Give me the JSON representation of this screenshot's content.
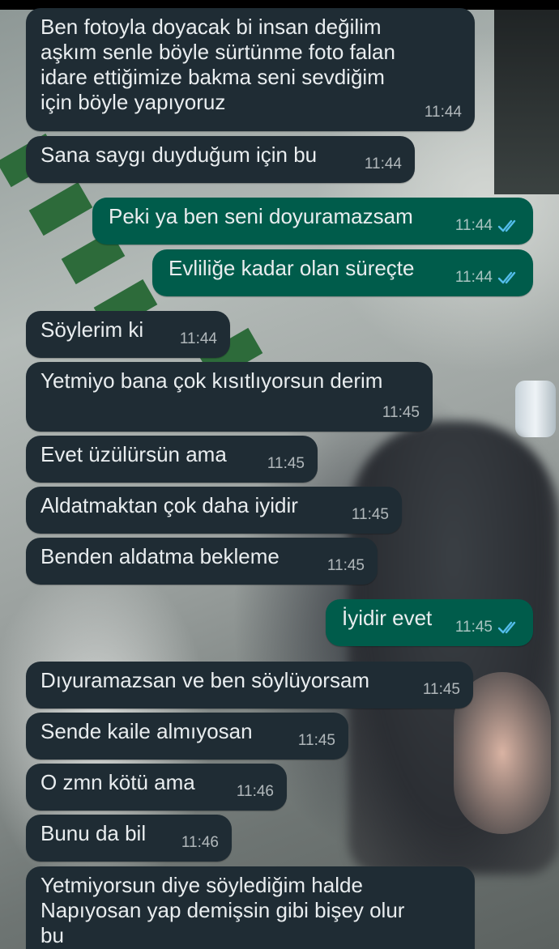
{
  "colors": {
    "incoming_bubble": "#1f2c34",
    "outgoing_bubble": "#005c4b",
    "text": "#e9edef",
    "read_ticks": "#53bdeb"
  },
  "messages": [
    {
      "direction": "incoming",
      "text": "Ben fotoyla doyacak bi insan değilim\naşkım senle böyle sürtünme foto falan\nidare ettiğimize bakma seni sevdiğim\niçin böyle yapıyoruz",
      "time": "11:44"
    },
    {
      "direction": "incoming",
      "text": "Sana saygı duyduğum için bu",
      "time": "11:44"
    },
    {
      "direction": "outgoing",
      "text": "Peki ya ben seni doyuramazsam",
      "time": "11:44",
      "status": "read-ticks-icon"
    },
    {
      "direction": "outgoing",
      "text": "Evliliğe kadar olan süreçte",
      "time": "11:44",
      "status": "read-ticks-icon"
    },
    {
      "direction": "incoming",
      "text": "Söylerim ki",
      "time": "11:44"
    },
    {
      "direction": "incoming",
      "text": "Yetmiyo bana çok kısıtlıyorsun derim",
      "time": "11:45"
    },
    {
      "direction": "incoming",
      "text": "Evet üzülürsün ama",
      "time": "11:45"
    },
    {
      "direction": "incoming",
      "text": "Aldatmaktan çok daha iyidir",
      "time": "11:45"
    },
    {
      "direction": "incoming",
      "text": "Benden aldatma bekleme",
      "time": "11:45"
    },
    {
      "direction": "outgoing",
      "text": "İyidir evet",
      "time": "11:45",
      "status": "read-ticks-icon"
    },
    {
      "direction": "incoming",
      "text": "Dıyuramazsan ve ben söylüyorsam",
      "time": "11:45"
    },
    {
      "direction": "incoming",
      "text": "Sende kaile almıyosan",
      "time": "11:45"
    },
    {
      "direction": "incoming",
      "text": "O zmn kötü ama",
      "time": "11:46"
    },
    {
      "direction": "incoming",
      "text": "Bunu da bil",
      "time": "11:46"
    },
    {
      "direction": "incoming",
      "text": "Yetmiyorsun diye söylediğim halde\nNapıyosan yap demişsin gibi bişey olur\nbu",
      "time": ""
    }
  ]
}
